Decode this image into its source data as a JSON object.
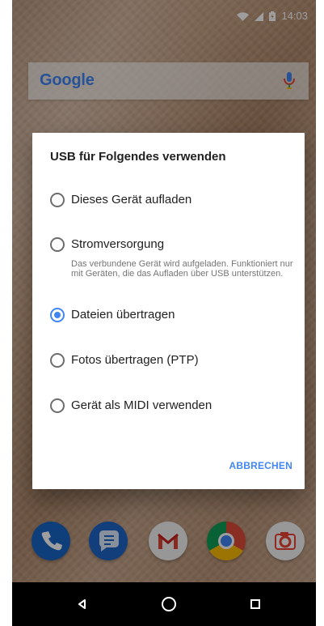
{
  "status_bar": {
    "time": "14:03"
  },
  "search_bar": {
    "logo_text": "Google",
    "icon_names": {
      "mic": "mic-icon"
    }
  },
  "dialog": {
    "title": "USB für Folgendes verwenden",
    "options": [
      {
        "label": "Dieses Gerät aufladen",
        "selected": false
      },
      {
        "label": "Stromversorgung",
        "summary": "Das verbundene Gerät wird aufgeladen. Funktioniert nur mit Geräten, die das Aufladen über USB unterstützen.",
        "selected": false
      },
      {
        "label": "Dateien übertragen",
        "selected": true
      },
      {
        "label": "Fotos übertragen (PTP)",
        "selected": false
      },
      {
        "label": "Gerät als MIDI verwenden",
        "selected": false
      }
    ],
    "cancel_label": "ABBRECHEN",
    "accent_color": "#4285f4"
  },
  "dock": {
    "apps": [
      {
        "icon": "phone-icon"
      },
      {
        "icon": "messages-icon"
      },
      {
        "icon": "gmail-icon"
      },
      {
        "icon": "chrome-icon"
      },
      {
        "icon": "camera-icon"
      }
    ]
  },
  "navigation": {
    "icons": [
      "back-icon",
      "home-icon",
      "recents-icon"
    ]
  },
  "colors": {
    "dialog_background": "#ffffff",
    "dialog_text": "#212121",
    "secondary_text": "#757575",
    "accent": "#4285f4",
    "navigation_bar": "#000000"
  }
}
